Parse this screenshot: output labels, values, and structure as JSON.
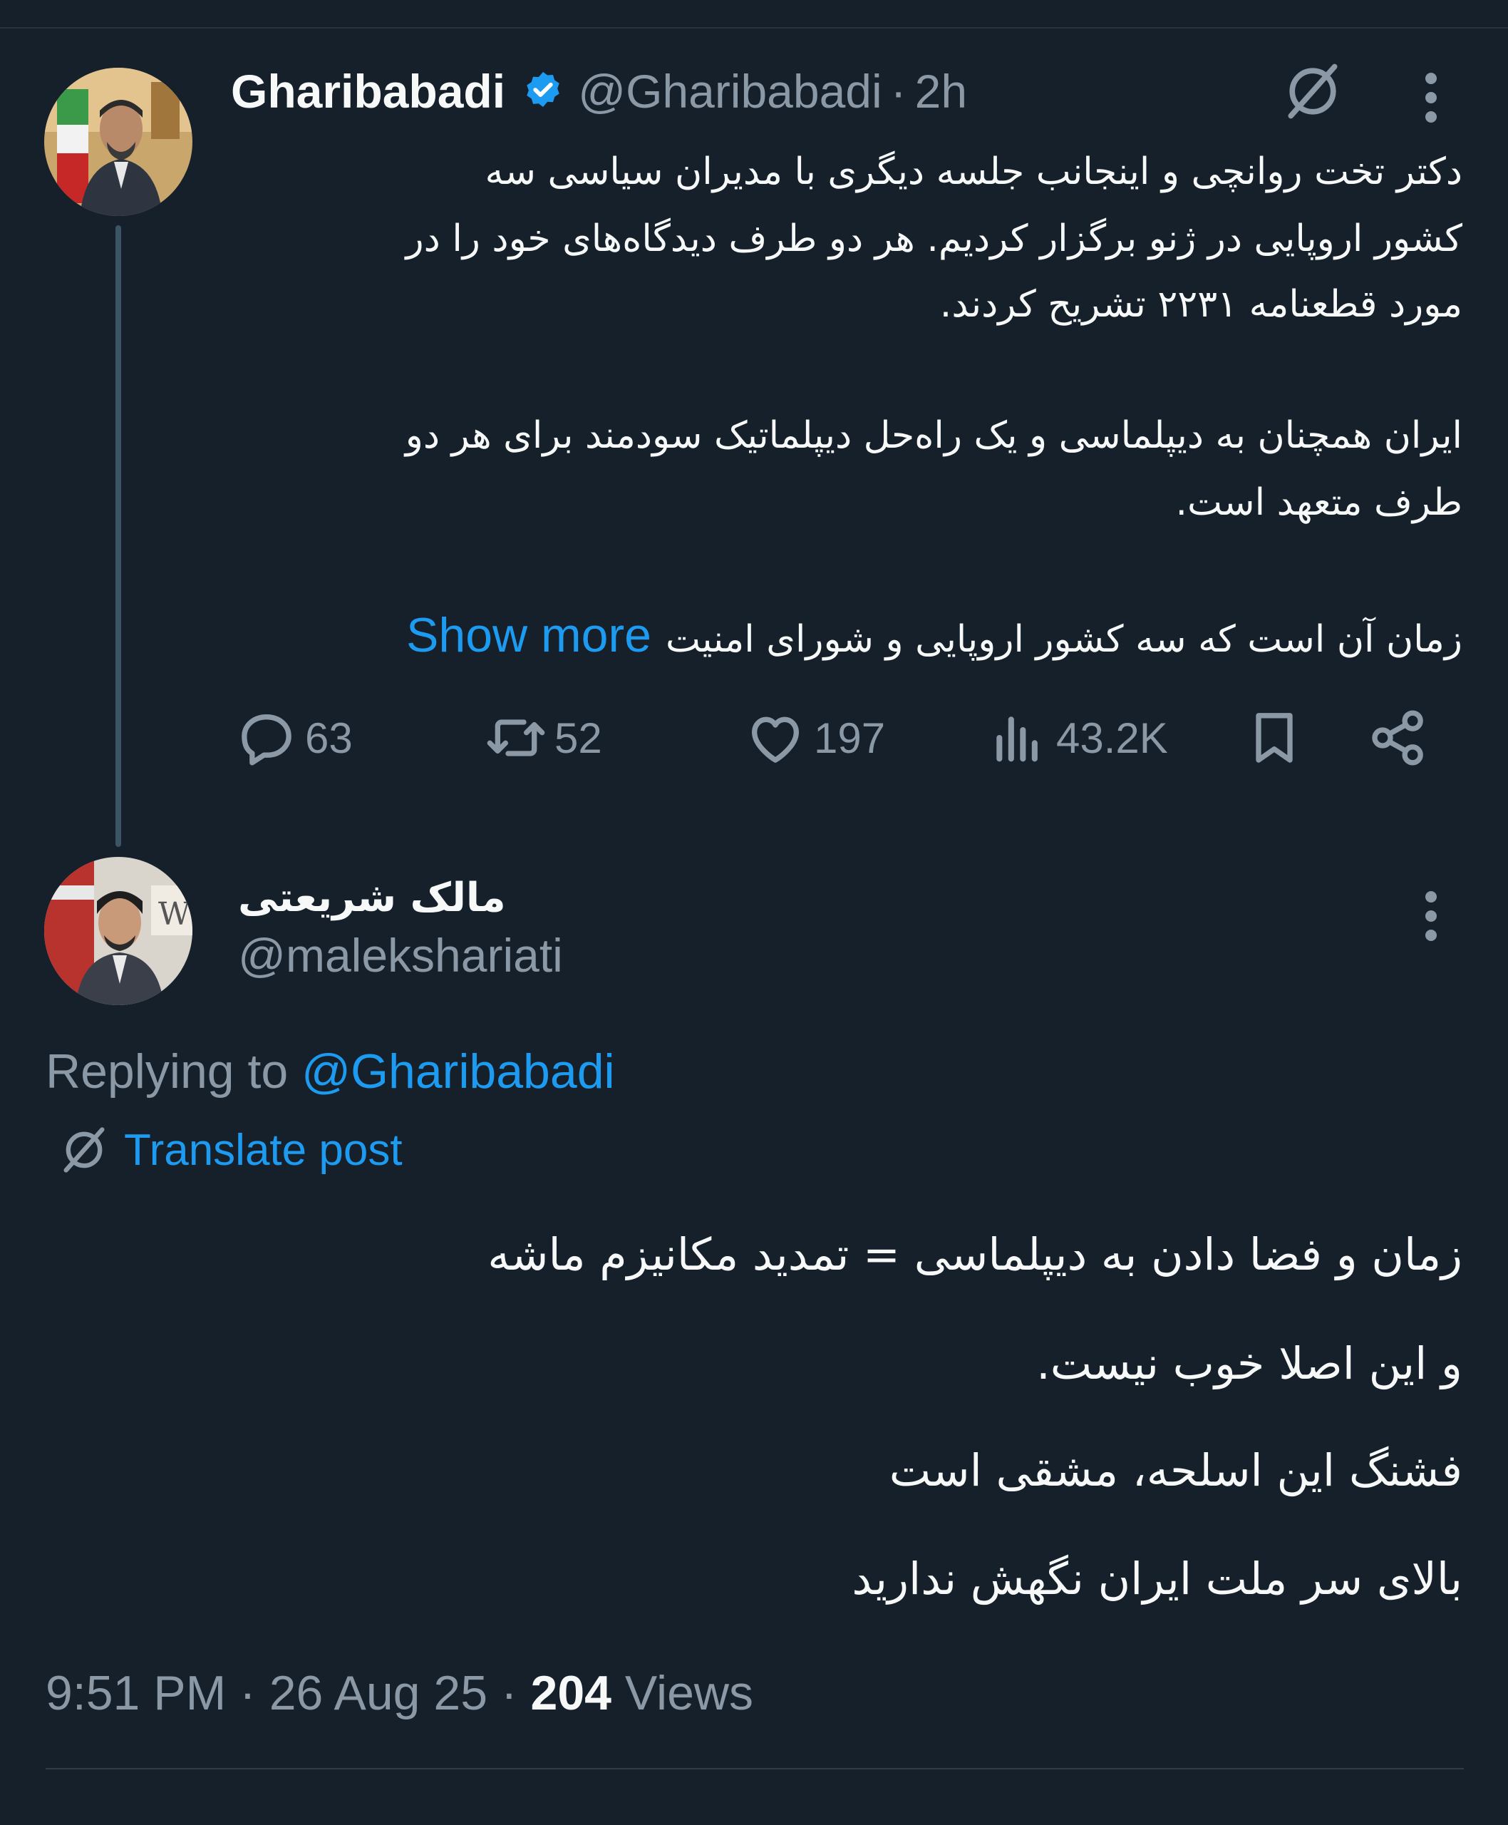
{
  "parent_tweet": {
    "display_name": "Gharibabadi",
    "handle": "@Gharibabadi",
    "separator": "·",
    "time_ago": "2h",
    "paragraph1_lines": [
      "دکتر  تخت روانچی و اینجانب جلسه دیگری با مدیران سیاسی سه",
      "کشور اروپایی در ژنو برگزار کردیم. هر دو طرف دیدگاه‌های خود را در",
      "مورد قطعنامه ۲۲۳۱ تشریح کردند."
    ],
    "paragraph2_lines": [
      "ایران همچنان به دیپلماسی و یک راه‌حل دیپلماتیک سودمند برای هر دو",
      "طرف متعهد است."
    ],
    "paragraph3_line": "زمان آن است که سه کشور اروپایی و شورای امنیت",
    "show_more": "Show more",
    "stats": {
      "replies": "63",
      "reposts": "52",
      "likes": "197",
      "views": "43.2K"
    }
  },
  "reply_tweet": {
    "display_name": "مالک شریعتی",
    "handle": "@malekshariati",
    "replying_prefix": "Replying to",
    "replying_to": "@Gharibabadi",
    "translate_label": "Translate post",
    "lines": [
      "زمان و فضا دادن به دیپلماسی = تمدید مکانیزم ماشه",
      "و این اصلا خوب نیست.",
      "فشنگ این اسلحه، مشقی است",
      "بالای سر ملت ایران نگهش ندارید"
    ],
    "time": "9:51 PM",
    "date": "26 Aug 25",
    "separator": "·",
    "views_count": "204",
    "views_label": "Views"
  },
  "icons": {
    "verified": "verified-badge-icon",
    "grok": "grok-icon",
    "more": "more-vertical-icon",
    "reply": "reply-icon",
    "repost": "repost-icon",
    "like": "heart-icon",
    "views": "views-chart-icon",
    "bookmark": "bookmark-icon",
    "share": "share-icon",
    "translate": "translate-icon"
  },
  "colors": {
    "background": "#15202b",
    "primary_text": "#f7f9f9",
    "secondary_text": "#8b98a5",
    "accent": "#1d9bf0",
    "thread_line": "#3d5466"
  }
}
